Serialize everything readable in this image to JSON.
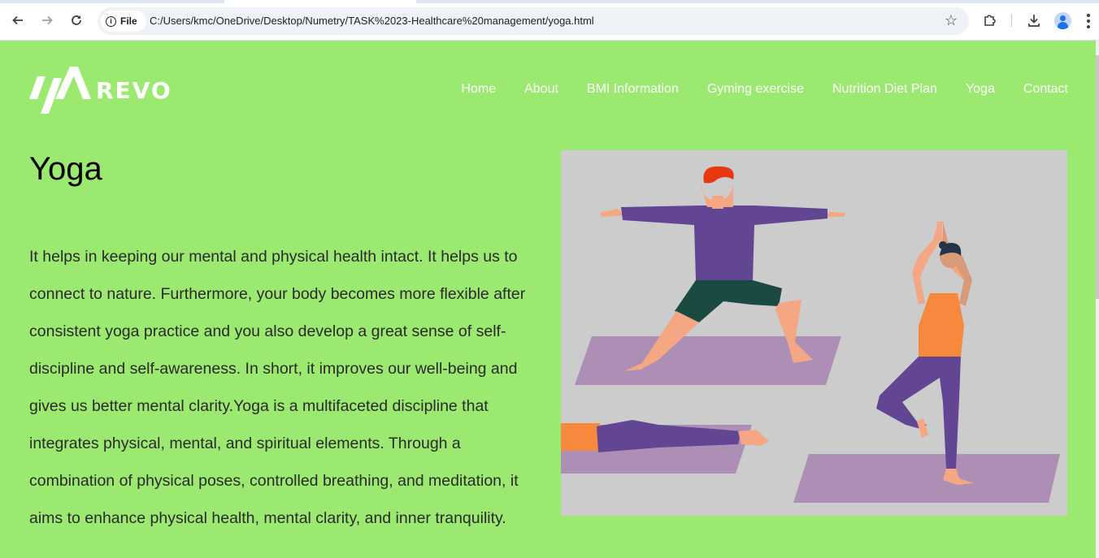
{
  "browser": {
    "url_chip": "File",
    "url": "C:/Users/kmc/OneDrive/Desktop/Numetry/TASK%2023-Healthcare%20management/yoga.html"
  },
  "brand": {
    "name": "REVO"
  },
  "nav": {
    "items": [
      "Home",
      "About",
      "BMI Information",
      "Gyming exercise",
      "Nutrition Diet Plan",
      "Yoga",
      "Contact"
    ]
  },
  "content": {
    "title": "Yoga",
    "paragraph": "It helps in keeping our mental and physical health intact. It helps us to connect to nature. Furthermore, your body becomes more flexible after consistent yoga practice and you also develop a great sense of self-discipline and self-awareness. In short, it improves our well-being and gives us better mental clarity.Yoga is a multifaceted discipline that integrates physical, mental, and spiritual elements. Through a combination of physical poses, controlled breathing, and meditation, it aims to enhance physical health, mental clarity, and inner tranquility."
  },
  "colors": {
    "page_background": "#9be970",
    "nav_text": "#ffffff",
    "illustration_background": "#cccccc",
    "mat": "#ad8fb6",
    "shirt_purple": "#634693",
    "shorts_green": "#1b4a42",
    "skin": "#f4a782",
    "hair_red": "#e8380f",
    "top_orange": "#f7893f"
  }
}
